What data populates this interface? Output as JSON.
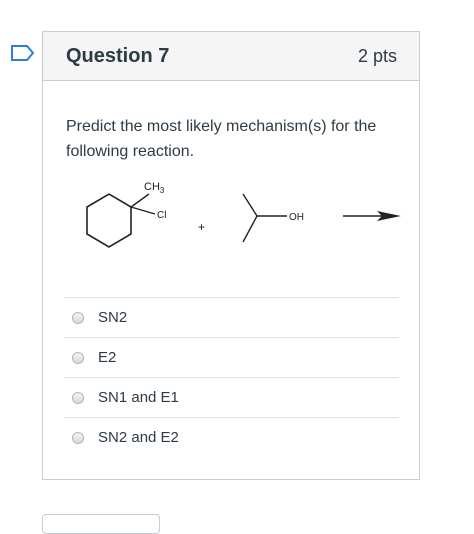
{
  "question": {
    "title": "Question 7",
    "points": "2 pts",
    "text": "Predict the most likely mechanism(s) for the following reaction.",
    "reaction_labels": {
      "methyl": "CH",
      "methyl_subscript": "3",
      "chloro": "Cl",
      "plus": "+",
      "hydroxyl": "OH"
    }
  },
  "answers": [
    {
      "label": "SN2",
      "selected": false
    },
    {
      "label": "E2",
      "selected": false
    },
    {
      "label": "SN1 and E1",
      "selected": false
    },
    {
      "label": "SN2 and E2",
      "selected": false
    }
  ],
  "colors": {
    "text": "#2d3b45",
    "border": "#c7cdd1",
    "header_bg": "#f5f5f5",
    "flag": "#2d7ee0"
  },
  "icons": {
    "flag": "bookmark-flag-icon"
  }
}
